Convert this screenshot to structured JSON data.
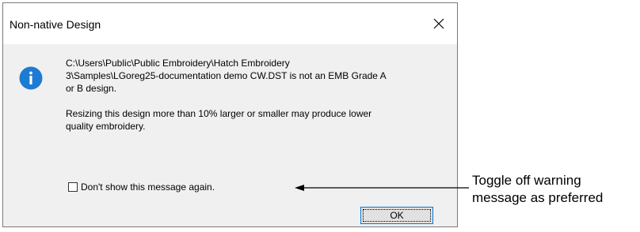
{
  "dialog": {
    "title": "Non-native Design",
    "close_icon": "close-icon",
    "info_icon": "info-icon",
    "message_line1": "C:\\Users\\Public\\Public Embroidery\\Hatch Embroidery",
    "message_line2": "3\\Samples\\LGoreg25-documentation demo CW.DST is not an EMB Grade A",
    "message_line3": "or B design.",
    "message_para2_line1": "Resizing this design more than 10% larger or smaller may produce lower",
    "message_para2_line2": "quality embroidery.",
    "checkbox_label": "Don't show this message again.",
    "checkbox_checked": false,
    "ok_label": "OK"
  },
  "callout": {
    "line1": "Toggle off warning",
    "line2": "message as preferred"
  },
  "colors": {
    "info_blue": "#1e7bd3",
    "button_focus": "#0078d7",
    "dialog_bg": "#f0f0f0"
  }
}
